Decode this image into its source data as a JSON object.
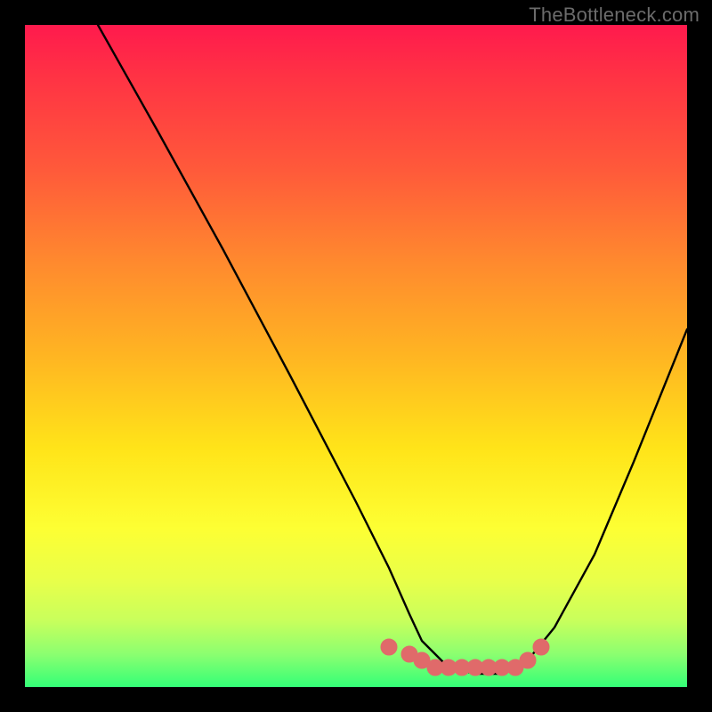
{
  "watermark": "TheBottleneck.com",
  "chart_data": {
    "type": "line",
    "title": "",
    "xlabel": "",
    "ylabel": "",
    "xlim": [
      0,
      100
    ],
    "ylim": [
      0,
      100
    ],
    "series": [
      {
        "name": "curve",
        "x": [
          11,
          20,
          30,
          40,
          50,
          55,
          58,
          60,
          64,
          68,
          72,
          76,
          80,
          86,
          92,
          100
        ],
        "y": [
          100,
          84,
          66,
          47,
          28,
          18,
          11,
          7,
          3,
          2,
          2,
          4,
          9,
          20,
          34,
          54
        ]
      },
      {
        "name": "marker-band",
        "x": [
          55,
          58,
          60,
          62,
          64,
          66,
          68,
          70,
          72,
          74,
          76,
          78
        ],
        "y": [
          6,
          5,
          4,
          3,
          3,
          3,
          3,
          3,
          3,
          3,
          4,
          6
        ]
      }
    ],
    "annotations": []
  },
  "colors": {
    "curve": "#000000",
    "markers": "#e06a6a",
    "watermark": "#6b6b6b"
  }
}
